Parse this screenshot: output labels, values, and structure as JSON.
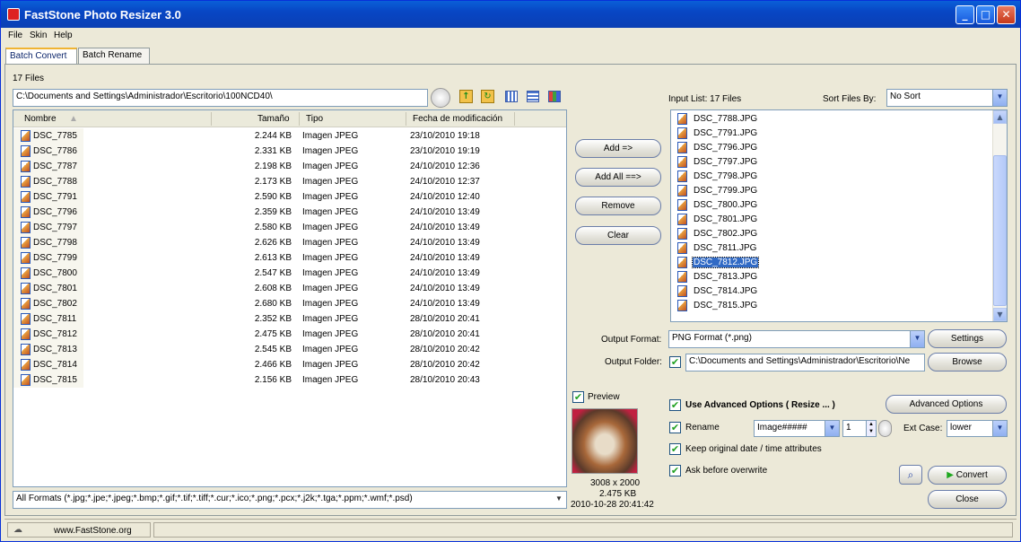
{
  "window": {
    "title": "FastStone Photo Resizer 3.0",
    "min": "_",
    "max": "□",
    "close": "✕"
  },
  "menu": [
    "File",
    "Skin",
    "Help"
  ],
  "tabs": [
    "Batch Convert",
    "Batch Rename"
  ],
  "files_count": "17 Files",
  "path": "C:\\Documents and Settings\\Administrador\\Escritorio\\100NCD40\\",
  "columns": [
    "Nombre",
    "Tamaño",
    "Tipo",
    "Fecha de modificación"
  ],
  "files": [
    {
      "name": "DSC_7785",
      "size": "2.244 KB",
      "type": "Imagen JPEG",
      "date": "23/10/2010 19:18"
    },
    {
      "name": "DSC_7786",
      "size": "2.331 KB",
      "type": "Imagen JPEG",
      "date": "23/10/2010 19:19"
    },
    {
      "name": "DSC_7787",
      "size": "2.198 KB",
      "type": "Imagen JPEG",
      "date": "24/10/2010 12:36"
    },
    {
      "name": "DSC_7788",
      "size": "2.173 KB",
      "type": "Imagen JPEG",
      "date": "24/10/2010 12:37"
    },
    {
      "name": "DSC_7791",
      "size": "2.590 KB",
      "type": "Imagen JPEG",
      "date": "24/10/2010 12:40"
    },
    {
      "name": "DSC_7796",
      "size": "2.359 KB",
      "type": "Imagen JPEG",
      "date": "24/10/2010 13:49"
    },
    {
      "name": "DSC_7797",
      "size": "2.580 KB",
      "type": "Imagen JPEG",
      "date": "24/10/2010 13:49"
    },
    {
      "name": "DSC_7798",
      "size": "2.626 KB",
      "type": "Imagen JPEG",
      "date": "24/10/2010 13:49"
    },
    {
      "name": "DSC_7799",
      "size": "2.613 KB",
      "type": "Imagen JPEG",
      "date": "24/10/2010 13:49"
    },
    {
      "name": "DSC_7800",
      "size": "2.547 KB",
      "type": "Imagen JPEG",
      "date": "24/10/2010 13:49"
    },
    {
      "name": "DSC_7801",
      "size": "2.608 KB",
      "type": "Imagen JPEG",
      "date": "24/10/2010 13:49"
    },
    {
      "name": "DSC_7802",
      "size": "2.680 KB",
      "type": "Imagen JPEG",
      "date": "24/10/2010 13:49"
    },
    {
      "name": "DSC_7811",
      "size": "2.352 KB",
      "type": "Imagen JPEG",
      "date": "28/10/2010 20:41"
    },
    {
      "name": "DSC_7812",
      "size": "2.475 KB",
      "type": "Imagen JPEG",
      "date": "28/10/2010 20:41"
    },
    {
      "name": "DSC_7813",
      "size": "2.545 KB",
      "type": "Imagen JPEG",
      "date": "28/10/2010 20:42"
    },
    {
      "name": "DSC_7814",
      "size": "2.466 KB",
      "type": "Imagen JPEG",
      "date": "28/10/2010 20:42"
    },
    {
      "name": "DSC_7815",
      "size": "2.156 KB",
      "type": "Imagen JPEG",
      "date": "28/10/2010 20:43"
    }
  ],
  "format_filter": "All Formats (*.jpg;*.jpe;*.jpeg;*.bmp;*.gif;*.tif;*.tiff;*.cur;*.ico;*.png;*.pcx;*.j2k;*.tga;*.ppm;*.wmf;*.psd)",
  "buttons": {
    "add": "Add =>",
    "add_all": "Add All ==>",
    "remove": "Remove",
    "clear": "Clear",
    "settings": "Settings",
    "browse": "Browse",
    "advanced": "Advanced Options",
    "convert": "Convert",
    "close": "Close"
  },
  "input_list": {
    "label": "Input List:  17 Files",
    "sort_label": "Sort Files By:",
    "sort_value": "No Sort",
    "items": [
      "DSC_7788.JPG",
      "DSC_7791.JPG",
      "DSC_7796.JPG",
      "DSC_7797.JPG",
      "DSC_7798.JPG",
      "DSC_7799.JPG",
      "DSC_7800.JPG",
      "DSC_7801.JPG",
      "DSC_7802.JPG",
      "DSC_7811.JPG",
      "DSC_7812.JPG",
      "DSC_7813.JPG",
      "DSC_7814.JPG",
      "DSC_7815.JPG"
    ],
    "selected": "DSC_7812.JPG"
  },
  "output": {
    "format_label": "Output Format:",
    "format_value": "PNG Format (*.png)",
    "folder_label": "Output Folder:",
    "folder_value": "C:\\Documents and Settings\\Administrador\\Escritorio\\Ne"
  },
  "preview": {
    "label": "Preview",
    "dims": "3008 x 2000",
    "size": "2.475 KB",
    "date": "2010-10-28 20:41:42"
  },
  "options": {
    "advanced": "Use Advanced Options ( Resize ... )",
    "rename": "Rename",
    "rename_pattern": "Image#####",
    "rename_start": "1",
    "ext_case_label": "Ext Case:",
    "ext_case_value": "lower",
    "keep_date": "Keep original date / time attributes",
    "ask_overwrite": "Ask before overwrite"
  },
  "status": {
    "url": "www.FastStone.org"
  }
}
